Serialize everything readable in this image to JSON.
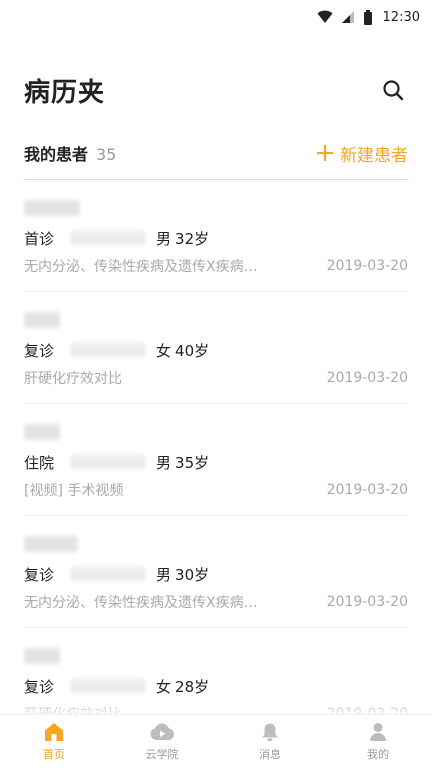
{
  "status_bar": {
    "time": "12:30"
  },
  "header": {
    "title": "病历夹",
    "search_icon": "search-icon"
  },
  "section": {
    "title": "我的患者",
    "count": "35",
    "new_label": "新建患者"
  },
  "colors": {
    "accent": "#f5a623",
    "muted": "#aaaaaa"
  },
  "patients": [
    {
      "type": "首诊",
      "gender": "男",
      "age": "32岁",
      "desc": "无内分泌、传染性疾病及遗传X疾病…",
      "date": "2019-03-20"
    },
    {
      "type": "复诊",
      "gender": "女",
      "age": "40岁",
      "desc": "肝硬化疗效对比",
      "date": "2019-03-20"
    },
    {
      "type": "住院",
      "gender": "男",
      "age": "35岁",
      "desc": "[视频] 手术视频",
      "date": "2019-03-20"
    },
    {
      "type": "复诊",
      "gender": "男",
      "age": "30岁",
      "desc": "无内分泌、传染性疾病及遗传X疾病…",
      "date": "2019-03-20"
    },
    {
      "type": "复诊",
      "gender": "女",
      "age": "28岁",
      "desc": "肝硬化疗效对比",
      "date": "2019-03-20"
    }
  ],
  "nav": [
    {
      "label": "首页",
      "icon": "home-icon"
    },
    {
      "label": "云学院",
      "icon": "cloud-play-icon"
    },
    {
      "label": "消息",
      "icon": "bell-icon"
    },
    {
      "label": "我的",
      "icon": "person-icon"
    }
  ]
}
